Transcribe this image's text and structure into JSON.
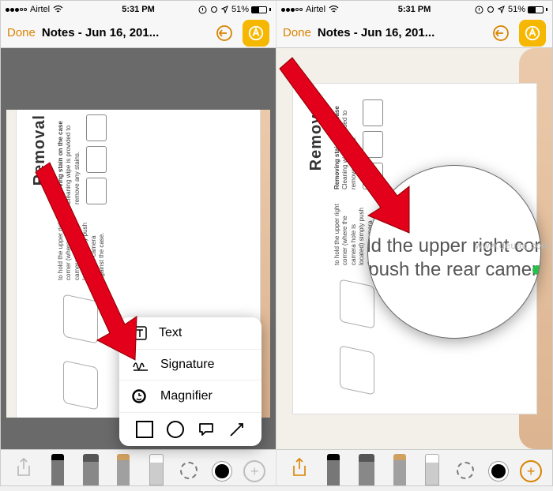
{
  "status": {
    "carrier": "Airtel",
    "time": "5:31 PM",
    "battery": "51%"
  },
  "nav": {
    "done": "Done",
    "title": "Notes - Jun 16, 201..."
  },
  "document": {
    "heading": "Removal",
    "block1_title": "Removing stain on the case",
    "block1_body": "Cleaning wipe is provided to remove any stains.",
    "block2_body": "to hold the upper right corner (where the camera hole is located) simply push the rear camera against the case."
  },
  "popup": {
    "text": "Text",
    "signature": "Signature",
    "magnifier": "Magnifier"
  },
  "loupe": {
    "line1": "old the upper right corne",
    "line2": "y push the rear camera a"
  },
  "watermark": "www.deuaq.com"
}
